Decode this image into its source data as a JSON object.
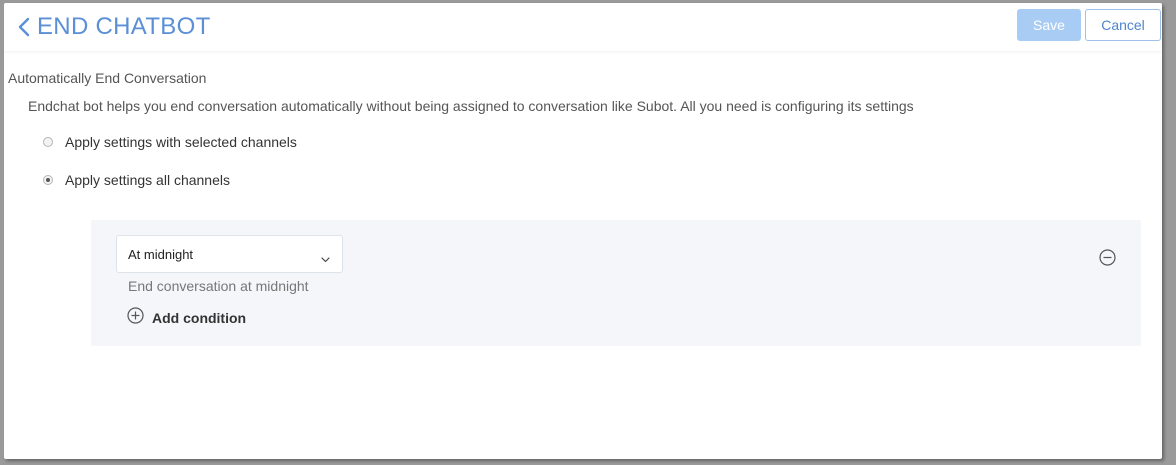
{
  "header": {
    "title": "END CHATBOT",
    "save_label": "Save",
    "cancel_label": "Cancel"
  },
  "section": {
    "title": "Automatically End Conversation",
    "description": "Endchat bot helps you end conversation automatically without being assigned to conversation like Subot. All you need is configuring its settings"
  },
  "options": [
    {
      "label": "Apply settings with selected channels",
      "checked": false
    },
    {
      "label": "Apply settings all channels",
      "checked": true
    }
  ],
  "condition": {
    "select_value": "At midnight",
    "description": "End conversation at midnight",
    "add_label": "Add condition"
  },
  "icons": {
    "back": "chevron-left-icon",
    "select": "chevron-down-icon",
    "add": "plus-circle-icon",
    "remove": "minus-circle-icon"
  },
  "colors": {
    "accent": "#5b8fd6",
    "save_disabled": "#a9ccf5",
    "panel_bg": "#f4f6f9"
  }
}
